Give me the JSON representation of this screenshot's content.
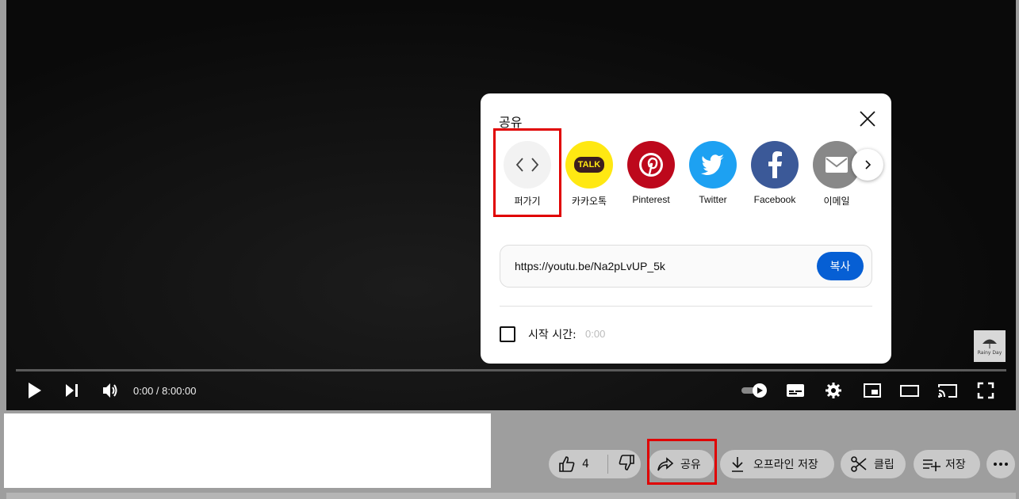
{
  "player": {
    "time": "0:00 / 8:00:00",
    "watermark": "Rainy Day"
  },
  "share_dialog": {
    "title": "공유",
    "targets": [
      {
        "label": "퍼가기",
        "icon": "embed-icon",
        "color": "#f2f2f2"
      },
      {
        "label": "카카오톡",
        "icon": "kakaotalk-icon",
        "color": "#ffe812"
      },
      {
        "label": "Pinterest",
        "icon": "pinterest-icon",
        "color": "#bd081c"
      },
      {
        "label": "Twitter",
        "icon": "twitter-icon",
        "color": "#1da1f2"
      },
      {
        "label": "Facebook",
        "icon": "facebook-icon",
        "color": "#3b5998"
      },
      {
        "label": "이메일",
        "icon": "email-icon",
        "color": "#888888"
      }
    ],
    "kakao_badge": "TALK",
    "url": "https://youtu.be/Na2pLvUP_5k",
    "copy_label": "복사",
    "start_time_label": "시작 시간:",
    "start_time_value": "0:00"
  },
  "actions": {
    "like_count": "4",
    "share_label": "공유",
    "download_label": "오프라인 저장",
    "clip_label": "클립",
    "save_label": "저장"
  },
  "colors": {
    "accent": "#065fd4",
    "highlight": "#e00000"
  }
}
